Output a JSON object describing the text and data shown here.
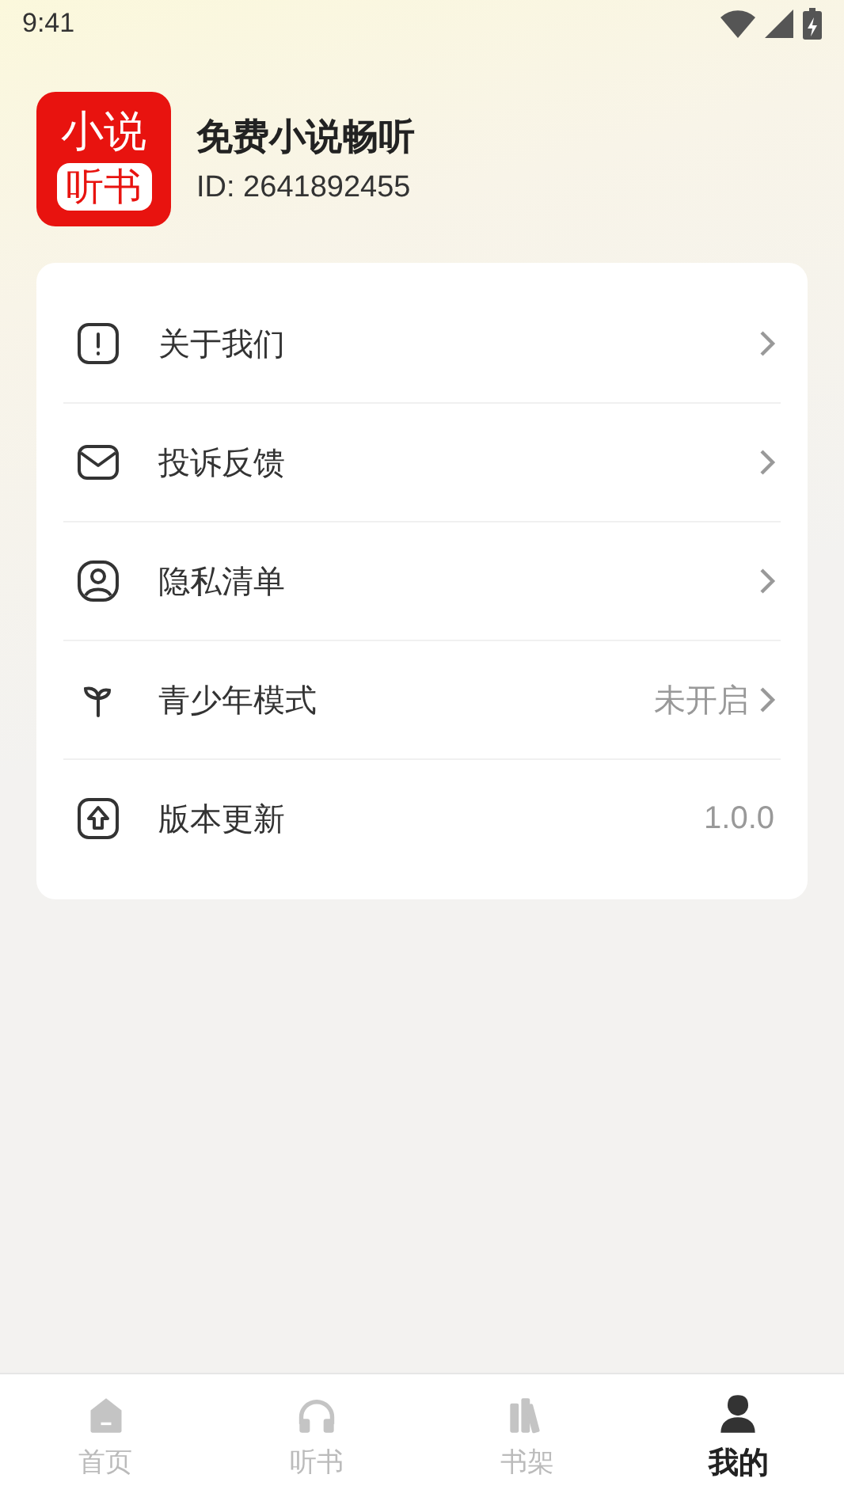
{
  "status_bar": {
    "time": "9:41"
  },
  "profile": {
    "logo_top": "小说",
    "logo_bottom": "听书",
    "name": "免费小说畅听",
    "id": "ID: 2641892455"
  },
  "menu": [
    {
      "kind": "about",
      "label": "关于我们",
      "arrow": true
    },
    {
      "kind": "feedback",
      "label": "投诉反馈",
      "arrow": true
    },
    {
      "kind": "privacy",
      "label": "隐私清单",
      "arrow": true
    },
    {
      "kind": "teen",
      "label": "青少年模式",
      "value": "未开启",
      "arrow": true
    },
    {
      "kind": "update",
      "label": "版本更新",
      "value": "1.0.0",
      "arrow": false
    }
  ],
  "tabs": [
    {
      "kind": "home",
      "label": "首页",
      "selected": false
    },
    {
      "kind": "listen",
      "label": "听书",
      "selected": false
    },
    {
      "kind": "shelf",
      "label": "书架",
      "selected": false
    },
    {
      "kind": "me",
      "label": "我的",
      "selected": true
    }
  ]
}
